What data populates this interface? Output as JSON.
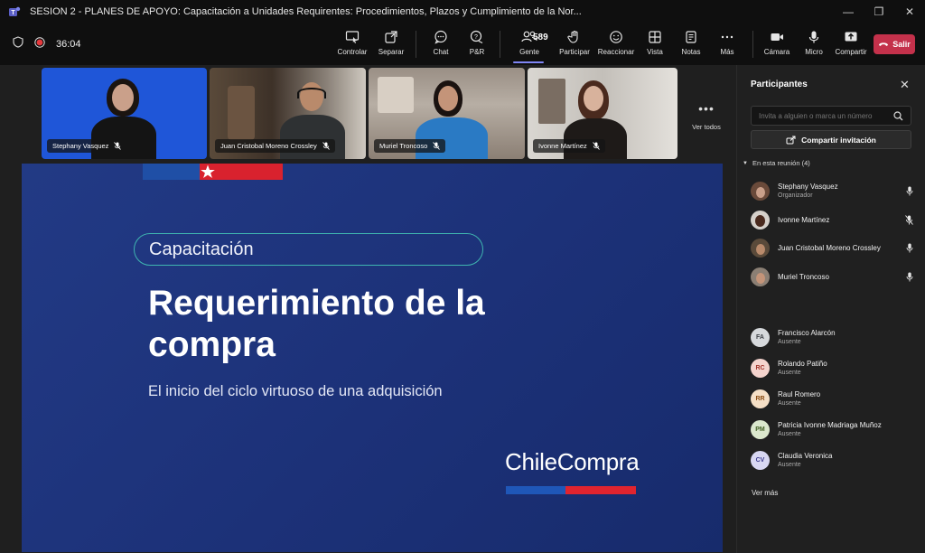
{
  "window": {
    "title": "SESION 2 - PLANES DE APOYO: Capacitación a Unidades Requirentes: Procedimientos, Plazos y Cumplimiento de la Nor...",
    "minimize": "—",
    "maximize": "❐",
    "close": "✕"
  },
  "toolbar": {
    "timer": "36:04",
    "buttons": {
      "controlar": "Controlar",
      "separar": "Separar",
      "chat": "Chat",
      "pr": "P&R",
      "gente": "Gente",
      "participar": "Participar",
      "reaccionar": "Reaccionar",
      "vista": "Vista",
      "notas": "Notas",
      "mas": "Más",
      "camara": "Cámara",
      "micro": "Micro",
      "compartir": "Compartir"
    },
    "people_count": "589",
    "leave_label": "Salir"
  },
  "video_tiles": [
    {
      "name": "Stephany Vasquez"
    },
    {
      "name": "Juan Cristobal Moreno Crossley"
    },
    {
      "name": "Muriel Troncoso"
    },
    {
      "name": "Ivonne Martínez"
    }
  ],
  "see_all": "Ver todos",
  "slide": {
    "pill_text": "Capacitación",
    "title_line1": "Requerimiento de la",
    "title_line2": "compra",
    "subtitle": "El inicio del ciclo virtuoso de una adquisición",
    "brand": "ChileCompra"
  },
  "panel": {
    "title": "Participantes",
    "invite_placeholder": "Invita a alguien o marca un número",
    "share_invite": "Compartir invitación",
    "in_meeting_header": "En esta reunión (4)",
    "in_meeting": [
      {
        "name": "Stephany Vasquez",
        "role": "Organizador"
      },
      {
        "name": "Ivonne Martínez",
        "role": ""
      },
      {
        "name": "Juan Cristobal Moreno Crossley",
        "role": ""
      },
      {
        "name": "Muriel Troncoso",
        "role": ""
      }
    ],
    "absent": [
      {
        "initials": "FA",
        "name": "Francisco Alarcón",
        "status": "Ausente",
        "color": "#d6d9dc"
      },
      {
        "initials": "RC",
        "name": "Rolando Patiño",
        "status": "Ausente",
        "color": "#f4d3cd"
      },
      {
        "initials": "RR",
        "name": "Raul Romero",
        "status": "Ausente",
        "color": "#f5dfc6"
      },
      {
        "initials": "PM",
        "name": "Patricia Ivonne Madriaga Muñoz",
        "status": "Ausente",
        "color": "#dbe8cd"
      },
      {
        "initials": "CV",
        "name": "Claudia Veronica",
        "status": "Ausente",
        "color": "#d8d7f2"
      }
    ],
    "see_more": "Ver más"
  },
  "colors": {
    "accent": "#7f85f5",
    "leave": "#c4314b",
    "slide_bg": "#1c3178",
    "chile_blue": "#1f4fa6",
    "chile_red": "#d9222e",
    "pill_border": "#3fb5b0"
  }
}
